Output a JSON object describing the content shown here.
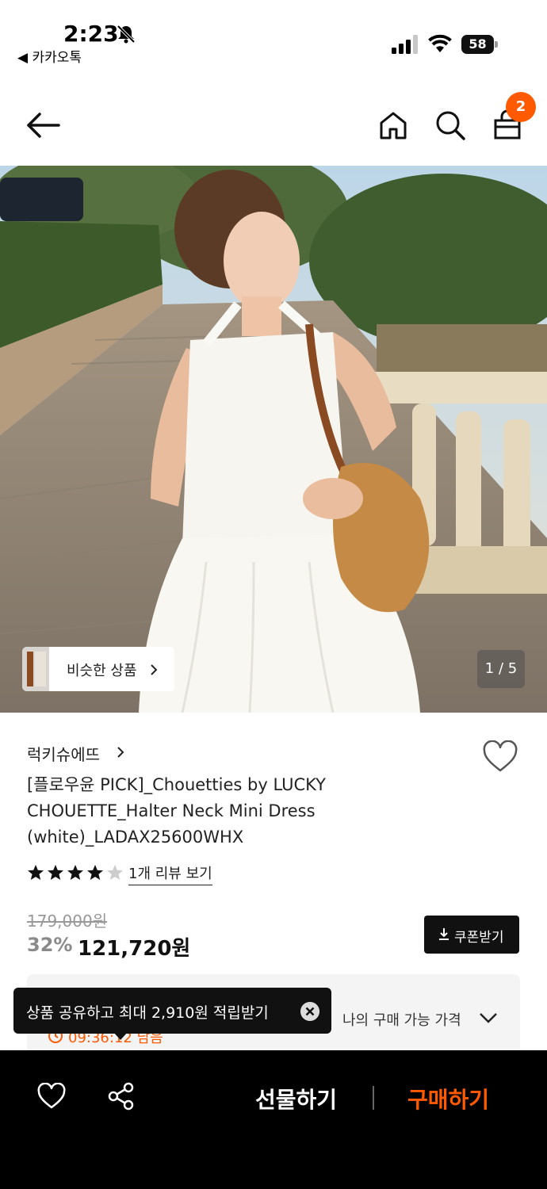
{
  "status_bar": {
    "time": "2:23",
    "back_app": "◀ 카카오톡",
    "battery": "58"
  },
  "header": {
    "cart_count": "2",
    "icons": [
      "back-arrow-icon",
      "home-icon",
      "search-icon",
      "shopping-bag-icon"
    ]
  },
  "gallery": {
    "similar_label": "비슷한 상품",
    "page_counter": "1 / 5"
  },
  "product": {
    "brand": "럭키슈에뜨",
    "title": "[플로우윤 PICK]_Chouetties by LUCKY CHOUETTE_Halter Neck Mini Dress (white)_LADAX25600WHX",
    "rating": 4,
    "rating_max": 5,
    "review_link": "1개 리뷰 보기",
    "original_price": "179,000원",
    "discount": "32%",
    "sale_price": "121,720원",
    "coupon_label": "쿠폰받기"
  },
  "price_card": {
    "timer": "09:36:12 남음",
    "my_price_label": "나의 구매 가능 가격"
  },
  "toast": {
    "text": "상품 공유하고 최대 2,910원 적립받기"
  },
  "bottom_bar": {
    "gift_label": "선물하기",
    "buy_label": "구매하기"
  },
  "colors": {
    "accent": "#ff5a00",
    "dark": "#111111"
  }
}
